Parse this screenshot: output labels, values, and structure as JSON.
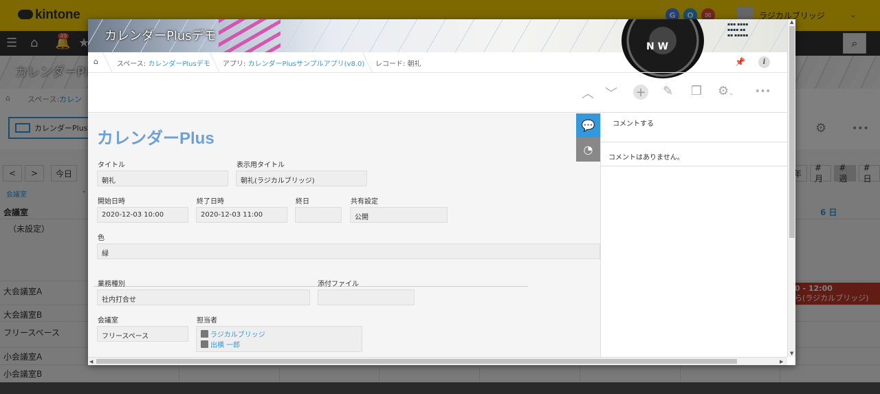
{
  "app": {
    "logo": "kintone",
    "notif_count": "49",
    "user_name": "ラジカルブリッジ"
  },
  "background": {
    "cover_title": "カレンダーPlus",
    "crumb_prefix": "スペース:",
    "crumb_space": "カレン",
    "view_button": "カレンダーPlus",
    "nav": {
      "prev": "<",
      "next": ">",
      "today": "今日",
      "year": "年",
      "month": "#月",
      "week": "#週",
      "day": "#日"
    },
    "room_filter": "会議室",
    "room_header": "会議室",
    "day_header": "6 日",
    "rooms": [
      "（未設定）",
      "大会議室A",
      "大会議室B",
      "フリースペース",
      "小会議室A",
      "小会議室B"
    ],
    "event": {
      "time": "0 - 12:00",
      "title": "ら(ラジカルブリッジ)"
    }
  },
  "modal": {
    "cover_title": "カレンダーPlusデモ",
    "breadcrumb": {
      "space_label": "スペース:",
      "space_name": "カレンダーPlusデモ",
      "app_label": "アプリ:",
      "app_name": "カレンダーPlusサンプルアプリ(v8.0)",
      "record_label": "レコード:",
      "record_name": "朝礼"
    },
    "record_heading": "カレンダーPlus",
    "fields": {
      "title": {
        "label": "タイトル",
        "value": "朝礼"
      },
      "display_title": {
        "label": "表示用タイトル",
        "value": "朝礼(ラジカルブリッジ)"
      },
      "start": {
        "label": "開始日時",
        "value": "2020-12-03 10:00"
      },
      "end": {
        "label": "終了日時",
        "value": "2020-12-03 11:00"
      },
      "all_day": {
        "label": "終日",
        "value": ""
      },
      "sharing": {
        "label": "共有設定",
        "value": "公開"
      },
      "color": {
        "label": "色",
        "value": "緑"
      },
      "business_type": {
        "label": "業務種別",
        "value": "社内打合せ"
      },
      "attachment": {
        "label": "添付ファイル",
        "value": ""
      },
      "room": {
        "label": "会議室",
        "value": "フリースペース"
      },
      "assignee": {
        "label": "担当者",
        "users": [
          "ラジカルブリッジ",
          "出横 一郎"
        ]
      }
    },
    "comments": {
      "post_placeholder": "コメントする",
      "empty": "コメントはありません。"
    }
  },
  "colors": {
    "accent": "#3498db",
    "topbar": "#fbd300",
    "event": "#c0392b",
    "heading": "#6ea0d8"
  }
}
